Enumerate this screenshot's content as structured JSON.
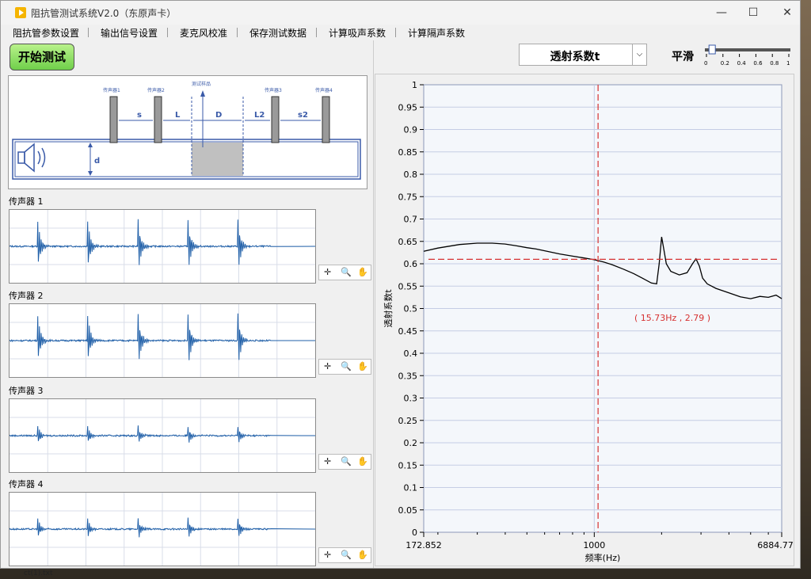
{
  "window": {
    "title": "阻抗管测试系统V2.0（东原声卡）",
    "minimize": "—",
    "maximize": "☐",
    "close": "✕"
  },
  "menu": [
    "阻抗管参数设置",
    "输出信号设置",
    "麦克风校准",
    "保存测试数据",
    "计算吸声系数",
    "计算隔声系数"
  ],
  "start_button": "开始测试",
  "diagram": {
    "mics": [
      "传声器1",
      "传声器2",
      "传声器3",
      "传声器4"
    ],
    "sample_label": "测试样品",
    "dims": [
      "s",
      "L",
      "D",
      "L2",
      "s2",
      "d"
    ]
  },
  "scopes": [
    {
      "label": "传声器 1",
      "amplitude": 1.0
    },
    {
      "label": "传声器 2",
      "amplitude": 1.0
    },
    {
      "label": "传声器 3",
      "amplitude": 0.35
    },
    {
      "label": "传声器 4",
      "amplitude": 0.4
    }
  ],
  "scope_tools": [
    "✛",
    "🔍",
    "✋"
  ],
  "plot_selector": {
    "value": "透射系数t",
    "arrow": "⌵"
  },
  "smooth": {
    "label": "平滑",
    "ticks": [
      "0",
      "0.2",
      "0.4",
      "0.6",
      "0.8",
      "1"
    ],
    "value": 0.05
  },
  "desktop": {
    "text": "ct(1).txt",
    "edge": "2"
  },
  "chart_data": {
    "type": "line",
    "xlabel": "频率(Hz)",
    "ylabel": "透射系数t",
    "x_scale": "log",
    "xlim": [
      172.852,
      6884.77
    ],
    "x_ticks": [
      "172.852",
      "1000",
      "6884.77"
    ],
    "ylim": [
      0,
      1
    ],
    "y_ticks": [
      "0",
      "0.05",
      "0.1",
      "0.15",
      "0.2",
      "0.25",
      "0.3",
      "0.35",
      "0.4",
      "0.45",
      "0.5",
      "0.55",
      "0.6",
      "0.65",
      "0.7",
      "0.75",
      "0.8",
      "0.85",
      "0.9",
      "0.95",
      "1"
    ],
    "grid": true,
    "cursor": {
      "x": 1040,
      "y": 0.61,
      "label": "( 15.73Hz , 2.79 )",
      "color": "#d63030"
    },
    "series": [
      {
        "color": "#000000",
        "x": [
          172.852,
          200,
          250,
          300,
          350,
          400,
          450,
          500,
          550,
          600,
          700,
          800,
          900,
          1000,
          1100,
          1200,
          1350,
          1500,
          1650,
          1800,
          1900,
          1950,
          2000,
          2050,
          2100,
          2200,
          2400,
          2600,
          2750,
          2850,
          2950,
          3050,
          3200,
          3500,
          4000,
          4500,
          5000,
          5500,
          6000,
          6500,
          6884.77
        ],
        "y": [
          0.628,
          0.635,
          0.643,
          0.646,
          0.646,
          0.644,
          0.64,
          0.636,
          0.633,
          0.629,
          0.622,
          0.617,
          0.613,
          0.609,
          0.604,
          0.598,
          0.588,
          0.578,
          0.567,
          0.557,
          0.555,
          0.6,
          0.66,
          0.63,
          0.6,
          0.583,
          0.575,
          0.58,
          0.6,
          0.611,
          0.595,
          0.568,
          0.555,
          0.545,
          0.535,
          0.526,
          0.522,
          0.527,
          0.525,
          0.53,
          0.522
        ]
      }
    ]
  }
}
